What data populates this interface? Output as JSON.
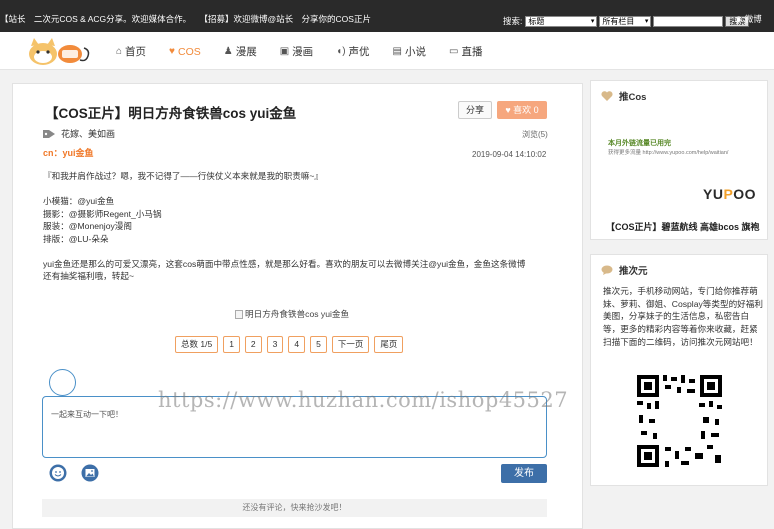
{
  "topbar": {
    "ticker": [
      "【站长",
      "二次元COS & ACG分享。欢迎媒体合作。",
      "【招募】欢迎微博@站长",
      "分享你的COS正片"
    ],
    "search_label": "搜索:",
    "select_field": "标题",
    "select_column": "所有栏目",
    "search_button": "搜索",
    "weibo": "微博"
  },
  "nav": {
    "items": [
      {
        "label": "首页",
        "icon": "home-icon"
      },
      {
        "label": "COS",
        "icon": "heart-icon"
      },
      {
        "label": "漫展",
        "icon": "group-icon"
      },
      {
        "label": "漫画",
        "icon": "picture-icon"
      },
      {
        "label": "声优",
        "icon": "volume-icon"
      },
      {
        "label": "小说",
        "icon": "book-icon"
      },
      {
        "label": "直播",
        "icon": "monitor-icon"
      }
    ],
    "active_index": 1
  },
  "article": {
    "title": "【COS正片】明日方舟食铁兽cos yui金鱼",
    "share_label": "分享",
    "like_label": "喜欢 0",
    "tags": "花嫁、美如画",
    "views": "浏览(5)",
    "author": "cn：yui金鱼",
    "date": "2019-09-04 14:10:02",
    "quote": "『和我并肩作战过？嗯，我不记得了——行侠仗义本来就是我的职责嘛~』",
    "credits": [
      "小模猫：@yui金鱼",
      "摄影：@摄影师Regent_小马锅",
      "服装：@Monenjoy漫阁",
      "排版：@LU-朵朵"
    ],
    "paragraph_1": "yui金鱼还是那么的可爱又漂亮，这套cos萌面中带点性感，就是那么好看。喜欢的朋友可以去微博关注@yui金鱼，金鱼这条微博",
    "paragraph_2": "还有抽奖福利哦，转起~",
    "image_alt": "明日方舟食铁兽cos yui金鱼"
  },
  "pager": {
    "total": "总数 1/5",
    "pages": [
      "1",
      "2",
      "3",
      "4",
      "5"
    ],
    "next": "下一页",
    "last": "尾页"
  },
  "comments": {
    "placeholder": "一起来互动一下吧！",
    "publish": "发布",
    "empty": "还没有评论，快来抢沙发吧！"
  },
  "watermark": "https://www.huzhan.com/ishop45527",
  "sidebar": {
    "card1": {
      "title": "推Cos",
      "ad_title": "本月外链流量已用完",
      "ad_sub": "获得更多流量 http://www.yupoo.com/help/waitian/",
      "ad_brand_a": "YU",
      "ad_brand_b": "P",
      "ad_brand_c": "OO",
      "link": "【COS正片】碧蓝航线 高雄bcos 旗袍"
    },
    "card2": {
      "title": "推次元",
      "description": "推次元，手机移动网站，专门给你推荐萌妹、萝莉、御姐、Cosplay等类型的好福利美图，分享妹子的生活信息，私密告白等，更多的精彩内容等着你来收藏，赶紧扫描下面的二维码，访问推次元网站吧！"
    }
  },
  "colors": {
    "accent": "#f28b3b",
    "like": "#f6a77e",
    "primary": "#3d6fa8",
    "topbar": "#2a2a2a"
  }
}
